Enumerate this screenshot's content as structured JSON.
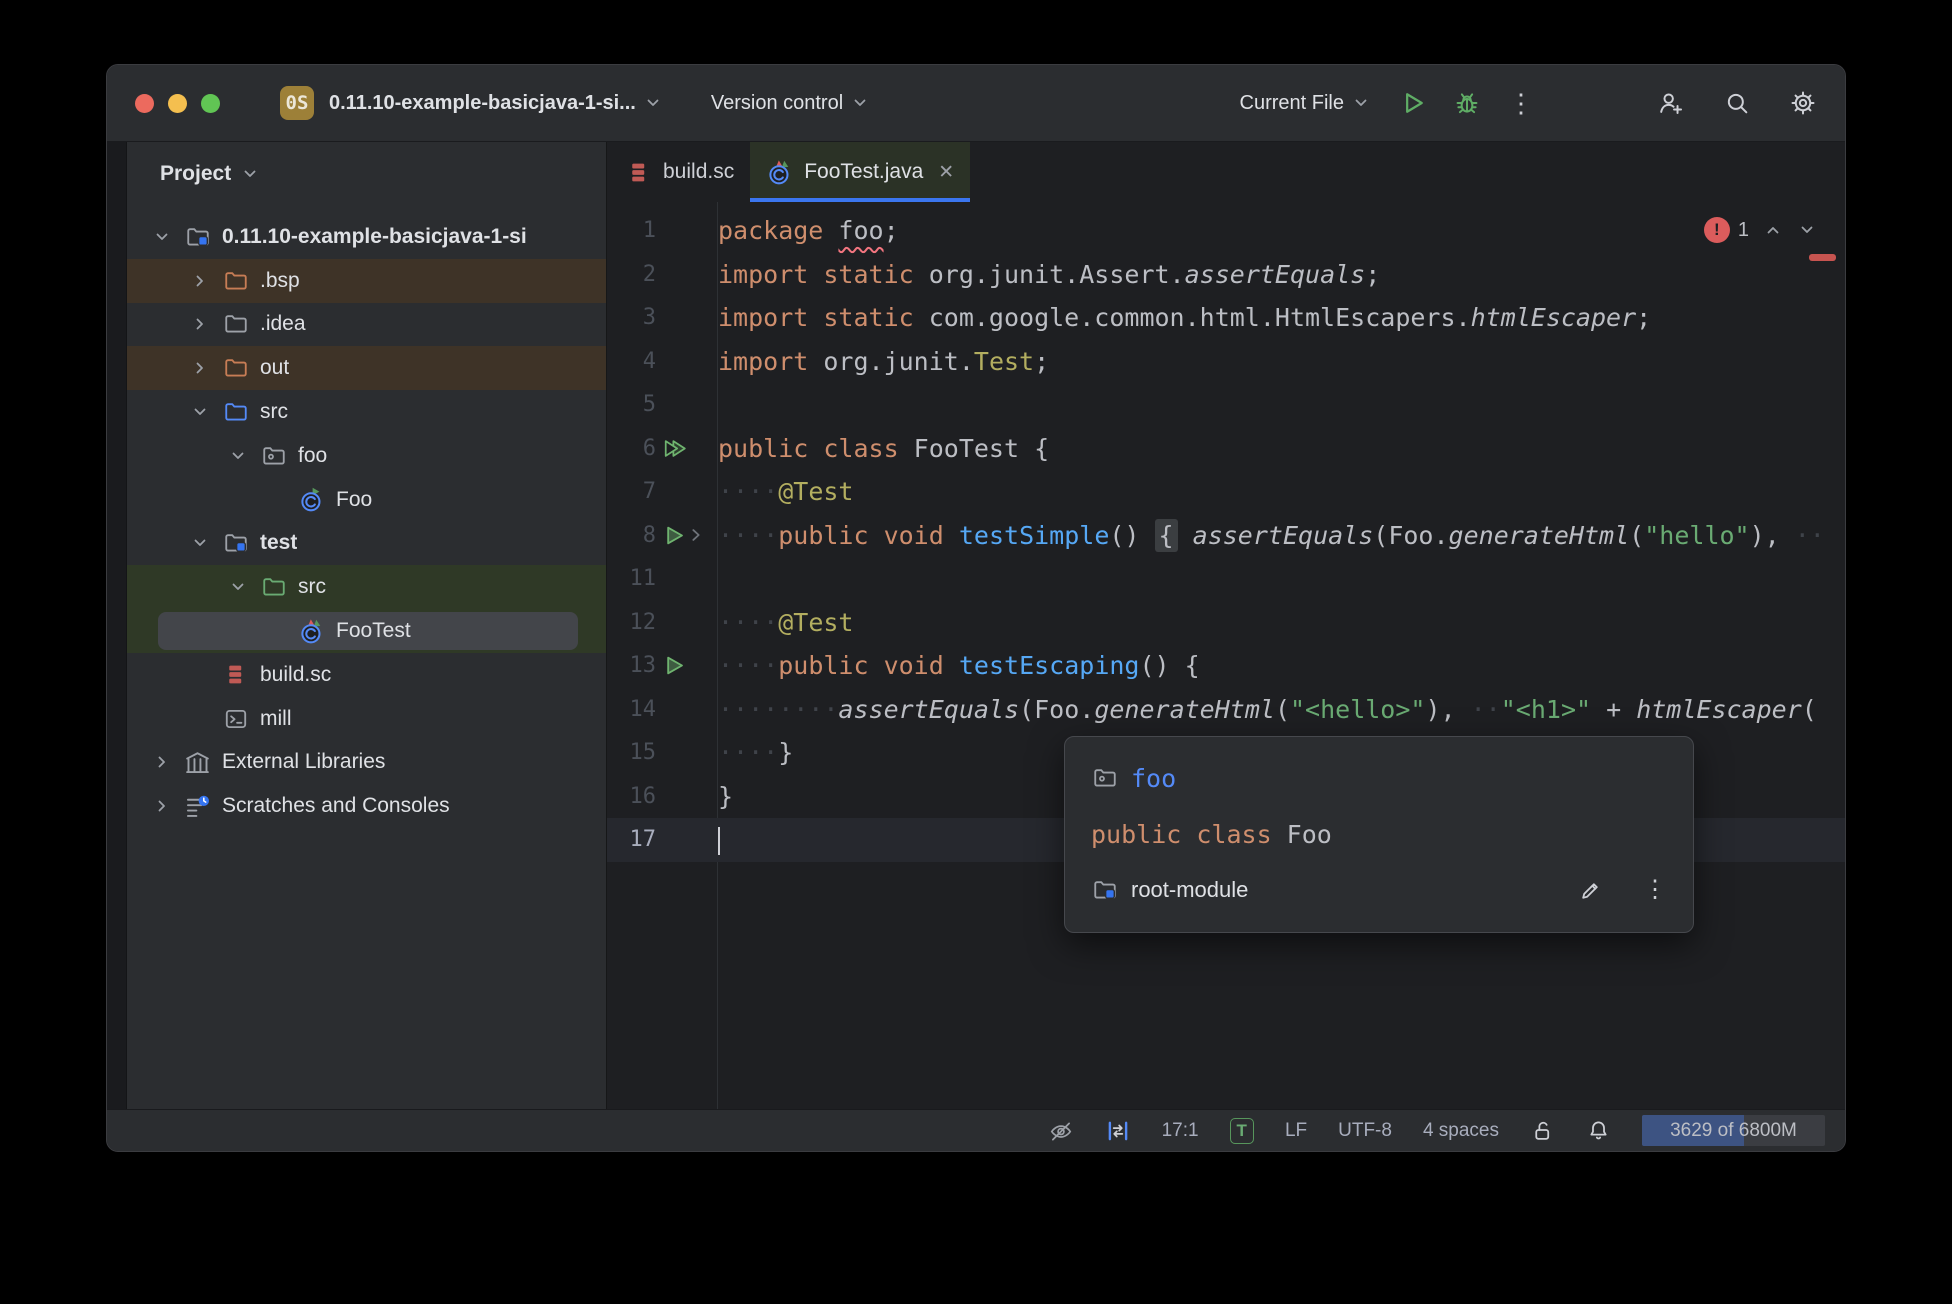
{
  "palette": {
    "accent_blue": "#3574F0",
    "error_red": "#DB5C5C",
    "run_green": "#5FAD65",
    "keyword_orange": "#CF8E6D",
    "string_green": "#6AAB73",
    "annotation_yellow": "#B3AE60",
    "method_blue": "#56A8F5",
    "editor_bg": "#1E1F22",
    "panel_bg": "#2B2D30",
    "excluded_row": "#3E3327",
    "test_row": "#2F3926"
  },
  "titlebar": {
    "avatar_text": "0S",
    "project_name": "0.11.10-example-basicjava-1-si...",
    "vcs_label": "Version control",
    "run_config": "Current File"
  },
  "tabs": [
    {
      "label": "build.sc",
      "icon": "scala-file",
      "active": false
    },
    {
      "label": "FooTest.java",
      "icon": "test-class",
      "active": true,
      "close": "✕"
    }
  ],
  "project_panel": {
    "title": "Project",
    "items": [
      {
        "label": "0.11.10-example-basicjava-1-si",
        "icon": "module-folder",
        "level": 0,
        "chevron": "down",
        "bold": true
      },
      {
        "label": ".bsp",
        "icon": "folder-excluded",
        "level": 1,
        "chevron": "right",
        "bg": "excluded"
      },
      {
        "label": ".idea",
        "icon": "folder-grey",
        "level": 1,
        "chevron": "right"
      },
      {
        "label": "out",
        "icon": "folder-excluded",
        "level": 1,
        "chevron": "right",
        "bg": "excluded"
      },
      {
        "label": "src",
        "icon": "folder-source",
        "level": 1,
        "chevron": "down"
      },
      {
        "label": "foo",
        "icon": "package",
        "level": 2,
        "chevron": "down"
      },
      {
        "label": "Foo",
        "icon": "class-runnable",
        "level": 3
      },
      {
        "label": "test",
        "icon": "module-folder",
        "level": 1,
        "chevron": "down",
        "bold": true
      },
      {
        "label": "src",
        "icon": "folder-test",
        "level": 2,
        "chevron": "down",
        "bg": "test"
      },
      {
        "label": "FooTest",
        "icon": "test-class",
        "level": 3,
        "bg": "test",
        "selected": true
      },
      {
        "label": "build.sc",
        "icon": "scala-file",
        "level": 1
      },
      {
        "label": "mill",
        "icon": "terminal-file",
        "level": 1
      },
      {
        "label": "External Libraries",
        "icon": "libraries",
        "level": 0,
        "chevron": "right"
      },
      {
        "label": "Scratches and Consoles",
        "icon": "scratches",
        "level": 0,
        "chevron": "right"
      }
    ]
  },
  "editor": {
    "error_badge": "1",
    "lines": [
      {
        "num": "1",
        "tokens": [
          [
            "kw",
            "package"
          ],
          [
            "pl",
            " "
          ],
          [
            "er",
            "foo"
          ],
          [
            "pl",
            ";"
          ]
        ]
      },
      {
        "num": "2",
        "tokens": [
          [
            "kw",
            "import static"
          ],
          [
            "pl",
            " org.junit.Assert."
          ],
          [
            "it",
            "assertEquals"
          ],
          [
            "pl",
            ";"
          ]
        ]
      },
      {
        "num": "3",
        "tokens": [
          [
            "kw",
            "import static"
          ],
          [
            "pl",
            " com.google.common.html.HtmlEscapers."
          ],
          [
            "it",
            "htmlEscaper"
          ],
          [
            "pl",
            ";"
          ]
        ]
      },
      {
        "num": "4",
        "tokens": [
          [
            "kw",
            "import"
          ],
          [
            "pl",
            " org.junit."
          ],
          [
            "an",
            "Test"
          ],
          [
            "pl",
            ";"
          ]
        ]
      },
      {
        "num": "5",
        "tokens": []
      },
      {
        "num": "6",
        "gutter": "run-all",
        "tokens": [
          [
            "kw",
            "public class"
          ],
          [
            "pl",
            " FooTest {"
          ]
        ]
      },
      {
        "num": "7",
        "tokens": [
          [
            "ws",
            "····"
          ],
          [
            "an",
            "@Test"
          ]
        ]
      },
      {
        "num": "8",
        "gutter": "run",
        "fold": true,
        "tokens": [
          [
            "ws",
            "····"
          ],
          [
            "kw",
            "public void"
          ],
          [
            "pl",
            " "
          ],
          [
            "fn",
            "testSimple"
          ],
          [
            "pl",
            "() "
          ],
          [
            "fd",
            "{"
          ],
          [
            "pl",
            " "
          ],
          [
            "it",
            "assertEquals"
          ],
          [
            "pl",
            "(Foo."
          ],
          [
            "it",
            "generateHtml"
          ],
          [
            "pl",
            "("
          ],
          [
            "st",
            "\"hello\""
          ],
          [
            "pl",
            "), "
          ],
          [
            "ws",
            "··"
          ]
        ]
      },
      {
        "num": "11",
        "tokens": []
      },
      {
        "num": "12",
        "tokens": [
          [
            "ws",
            "····"
          ],
          [
            "an",
            "@Test"
          ]
        ]
      },
      {
        "num": "13",
        "gutter": "run",
        "tokens": [
          [
            "ws",
            "····"
          ],
          [
            "kw",
            "public void"
          ],
          [
            "pl",
            " "
          ],
          [
            "fn",
            "testEscaping"
          ],
          [
            "pl",
            "() {"
          ]
        ]
      },
      {
        "num": "14",
        "tokens": [
          [
            "ws",
            "········"
          ],
          [
            "it",
            "assertEquals"
          ],
          [
            "pl",
            "(Foo."
          ],
          [
            "it",
            "generateHtml"
          ],
          [
            "pl",
            "("
          ],
          [
            "st",
            "\"<hello>\""
          ],
          [
            "pl",
            "), "
          ],
          [
            "ws",
            "··"
          ],
          [
            "st",
            "\"<h1>\""
          ],
          [
            "pl",
            " + "
          ],
          [
            "it",
            "htmlEscaper"
          ],
          [
            "pl",
            "("
          ]
        ]
      },
      {
        "num": "15",
        "tokens": [
          [
            "ws",
            "····"
          ],
          [
            "pl",
            "}"
          ]
        ]
      },
      {
        "num": "16",
        "tokens": [
          [
            "pl",
            "}"
          ]
        ]
      },
      {
        "num": "17",
        "current": true,
        "caret": true,
        "tokens": []
      }
    ]
  },
  "popup": {
    "package_name": "foo",
    "class_keywords": "public class",
    "class_name": " Foo",
    "module_name": "root-module"
  },
  "statusbar": {
    "caret_position": "17:1",
    "mode_badge": "T",
    "line_separator": "LF",
    "encoding": "UTF-8",
    "indent_style": "4 spaces",
    "memory": "3629 of 6800M",
    "memory_fill_pct": 56
  }
}
